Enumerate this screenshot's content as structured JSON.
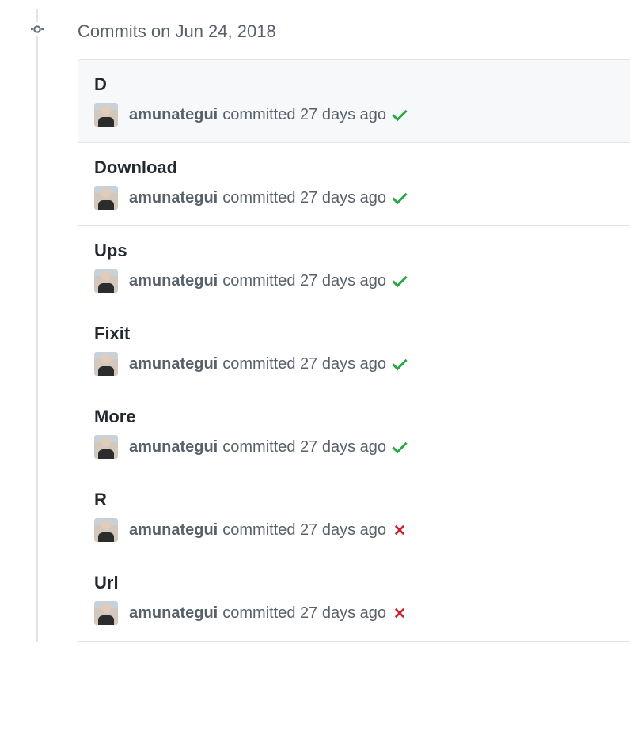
{
  "timeline": {
    "header": "Commits on Jun 24, 2018"
  },
  "commits": [
    {
      "title": "D",
      "author": "amunategui",
      "meta": "committed 27 days ago",
      "status": "success"
    },
    {
      "title": "Download",
      "author": "amunategui",
      "meta": "committed 27 days ago",
      "status": "success"
    },
    {
      "title": "Ups",
      "author": "amunategui",
      "meta": "committed 27 days ago",
      "status": "success"
    },
    {
      "title": "Fixit",
      "author": "amunategui",
      "meta": "committed 27 days ago",
      "status": "success"
    },
    {
      "title": "More",
      "author": "amunategui",
      "meta": "committed 27 days ago",
      "status": "success"
    },
    {
      "title": "R",
      "author": "amunategui",
      "meta": "committed 27 days ago",
      "status": "failure"
    },
    {
      "title": "Url",
      "author": "amunategui",
      "meta": "committed 27 days ago",
      "status": "failure"
    }
  ]
}
